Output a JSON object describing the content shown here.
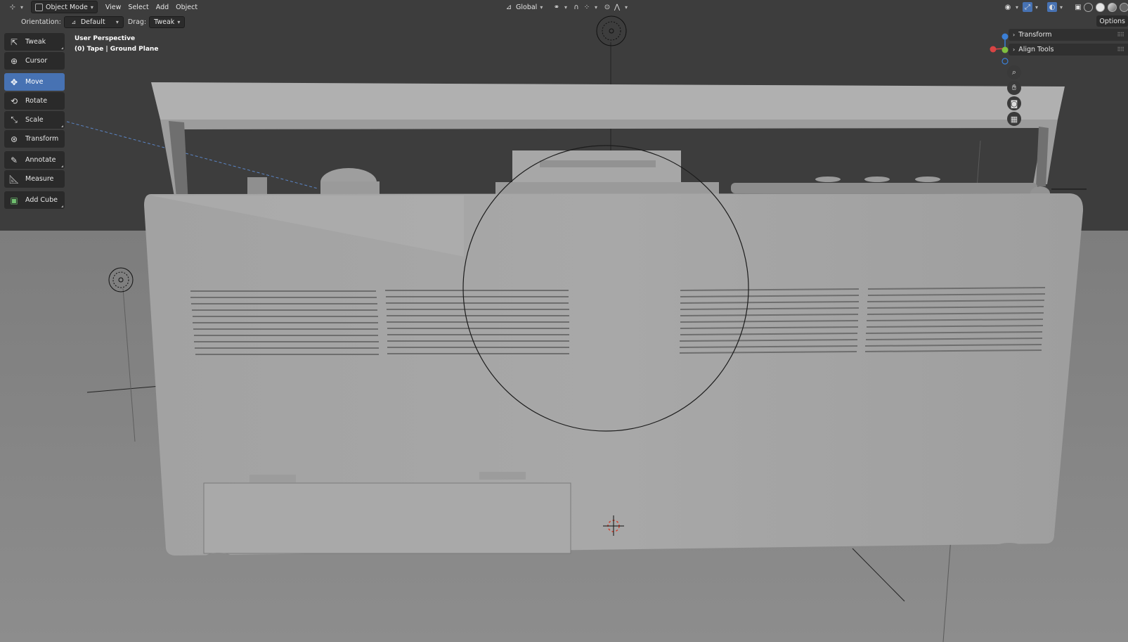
{
  "header": {
    "editor_type_icon": "axis-editor-icon",
    "mode": "Object Mode",
    "menus": [
      "View",
      "Select",
      "Add",
      "Object"
    ],
    "transform_orientation": "Global"
  },
  "subheader": {
    "orientation_label": "Orientation:",
    "orientation_value": "Default",
    "drag_label": "Drag:",
    "drag_value": "Tweak"
  },
  "toolbar": {
    "tools": [
      {
        "label": "Tweak",
        "icon": "tweak-icon"
      },
      {
        "label": "Cursor",
        "icon": "cursor-icon"
      },
      {
        "label": "Move",
        "icon": "move-icon",
        "active": true
      },
      {
        "label": "Rotate",
        "icon": "rotate-icon"
      },
      {
        "label": "Scale",
        "icon": "scale-icon"
      },
      {
        "label": "Transform",
        "icon": "transform-icon"
      },
      {
        "label": "Annotate",
        "icon": "annotate-icon"
      },
      {
        "label": "Measure",
        "icon": "measure-icon"
      },
      {
        "label": "Add Cube",
        "icon": "add-cube-icon"
      }
    ]
  },
  "viewport_info": {
    "line1": "User Perspective",
    "line2": "(0) Tape | Ground Plane"
  },
  "npanel": {
    "options": "Options",
    "tabs": [
      "Transform",
      "Align Tools"
    ]
  },
  "colors": {
    "accent": "#4772b3",
    "header_bg": "#3d3d3d",
    "panel_bg": "#2a2a2a",
    "floor": "#8a8a8a",
    "model": "#a3a3a3"
  }
}
